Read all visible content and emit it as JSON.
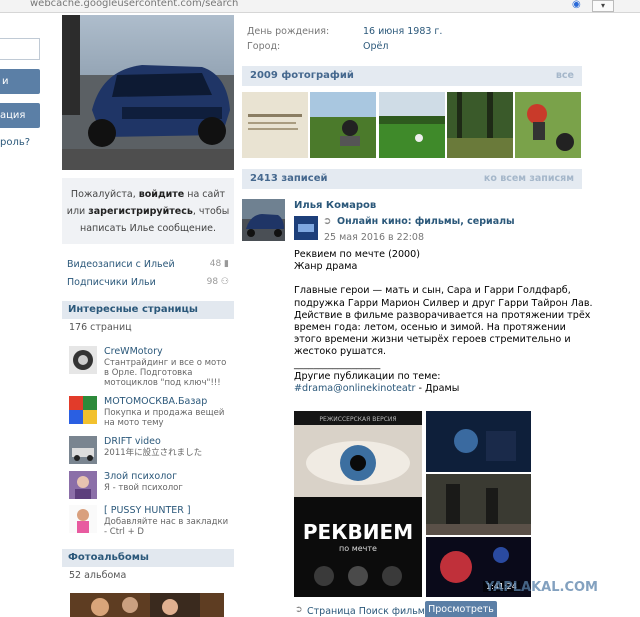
{
  "browser": {
    "url": "webcache.googleusercontent.com/search"
  },
  "left_strip": {
    "button1_label": "и",
    "button2_label": "ация",
    "link": "роль?"
  },
  "login_prompt": {
    "part1": "Пожалуйста, ",
    "login_word": "войдите",
    "part2": " на сайт или ",
    "register_word": "зарегистрируйтесь",
    "part3": ", чтобы написать Илье сообщение."
  },
  "stats": [
    {
      "label": "Видеозаписи с Ильей",
      "count": "48"
    },
    {
      "label": "Подписчики Ильи",
      "count": "98"
    }
  ],
  "interesting_pages": {
    "title": "Интересные страницы",
    "count": "176 страниц",
    "items": [
      {
        "name": "CreWMotory",
        "desc": "Стантрайдинг и все о мото в Орле. Подготовка мотоциклов \"под ключ\"!!!"
      },
      {
        "name": "МОТОМОСКВА.Базар",
        "desc": "Покупка и продажа вещей на мото тему"
      },
      {
        "name": "DRIFT video",
        "desc": "2011年に設立されました"
      },
      {
        "name": "Злой психолог",
        "desc": "Я - твой психолог"
      },
      {
        "name": "[ PUSSY HUNTER ]",
        "desc": "Добавляйте нас в закладки - Ctrl + D"
      }
    ]
  },
  "albums": {
    "title": "Фотоальбомы",
    "count": "52 альбома"
  },
  "info": {
    "birthday_label": "День рождения:",
    "birthday_value": "16 июня 1983 г.",
    "city_label": "Город:",
    "city_value": "Орёл"
  },
  "photos": {
    "title": "2009 фотографий",
    "link": "все"
  },
  "posts": {
    "title": "2413 записей",
    "link": "ко всем записям"
  },
  "post": {
    "author": "Илья Комаров",
    "repost_title": "Онлайн кино: фильмы, сериалы",
    "date": "25 мая 2016 в 22:08",
    "line1": "Реквием по мечте (2000)",
    "line2": "Жанр драма",
    "body": "Главные герои — мать и сын, Сара и Гарри Голдфарб, подружка Гарри Марион Силвер и друг Гарри Тайрон Лав. Действие в фильме разворачивается на протяжении трёх времен года: летом, осенью и зимой. На протяжении этого времени жизни четырёх героев стремительно и жестоко рушатся.",
    "divider": "__________________",
    "other": "Другие публикации по теме:",
    "tag": "#drama@onlinekinoteatr",
    "tag_suffix": " - Драмы",
    "poster_top": "РЕЖИССЕРСКАЯ ВЕРСИЯ",
    "poster_title": "РЕКВИЕМ",
    "poster_sub": "по мечте",
    "video_time": "1:41:24"
  },
  "footer": {
    "link": "Страница Поиск фильмов",
    "button": "Просмотреть"
  },
  "watermark": "YAPLAKAL.COM",
  "colors": {
    "link": "#2b587a",
    "header_bg": "#e4eaf1",
    "button": "#5b7fa6"
  }
}
